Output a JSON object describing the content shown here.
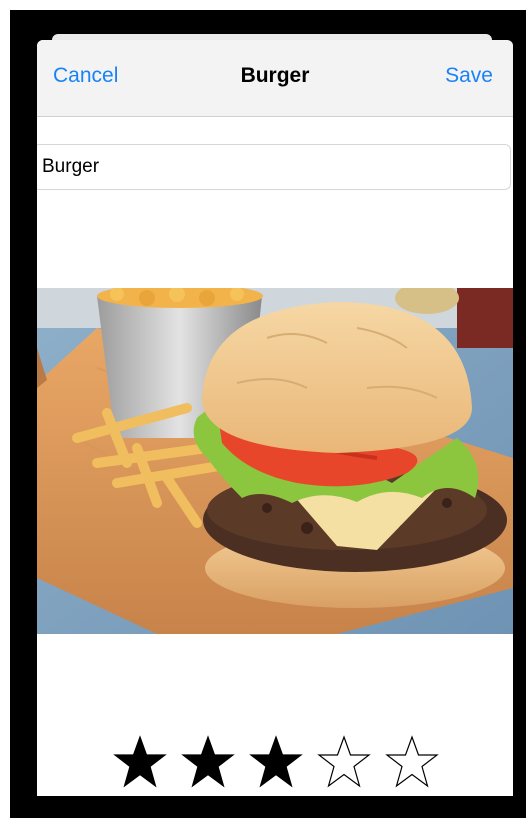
{
  "navbar": {
    "cancel_label": "Cancel",
    "title": "Burger",
    "save_label": "Save"
  },
  "meal_name": {
    "value": "Burger"
  },
  "photo": {
    "description_icon": "burger-photo"
  },
  "rating": {
    "value": 3,
    "max": 5
  },
  "colors": {
    "accent": "#1a82f7",
    "navbar_bg": "#f3f3f3",
    "star": "#000000"
  }
}
